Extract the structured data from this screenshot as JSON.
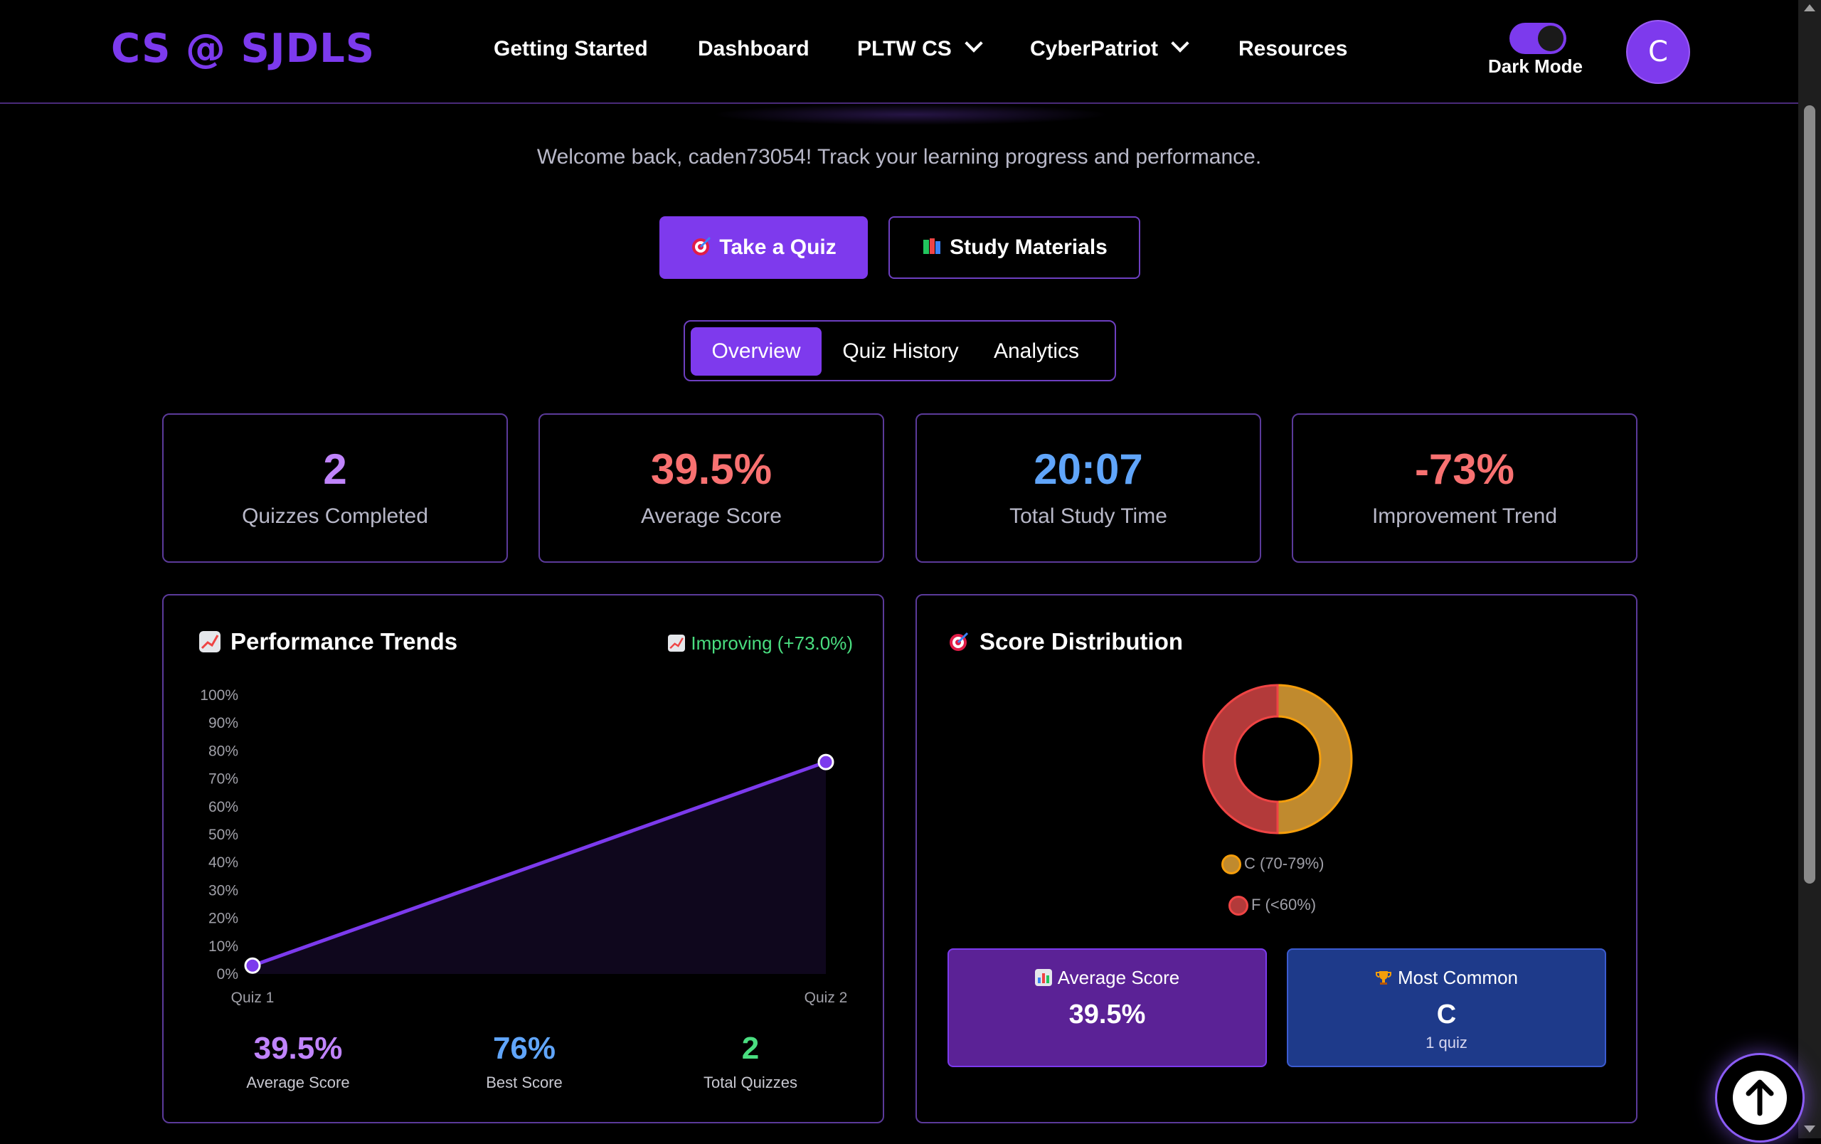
{
  "header": {
    "logo": "CS @ SJDLS",
    "nav": [
      "Getting Started",
      "Dashboard",
      "PLTW CS",
      "CyberPatriot",
      "Resources"
    ],
    "dark_mode_label": "Dark Mode",
    "dark_mode_on": true,
    "avatar_initial": "C"
  },
  "welcome": "Welcome back, caden73054! Track your learning progress and performance.",
  "actions": {
    "take_quiz": "Take a Quiz",
    "take_quiz_icon": "dart-target-icon",
    "study_materials": "Study Materials",
    "study_materials_icon": "books-icon"
  },
  "tabs": [
    "Overview",
    "Quiz History",
    "Analytics"
  ],
  "active_tab": "Overview",
  "stats": [
    {
      "value": "2",
      "label": "Quizzes Completed",
      "color": "#c084fc"
    },
    {
      "value": "39.5%",
      "label": "Average Score",
      "color": "#f87171"
    },
    {
      "value": "20:07",
      "label": "Total Study Time",
      "color": "#60a5fa"
    },
    {
      "value": "-73%",
      "label": "Improvement Trend",
      "color": "#f87171"
    }
  ],
  "trends": {
    "title": "Performance Trends",
    "badge": "Improving (+73.0%)",
    "summary": [
      {
        "value": "39.5%",
        "label": "Average Score",
        "color": "#c084fc"
      },
      {
        "value": "76%",
        "label": "Best Score",
        "color": "#60a5fa"
      },
      {
        "value": "2",
        "label": "Total Quizzes",
        "color": "#4ade80"
      }
    ]
  },
  "chart_data": {
    "type": "area",
    "categories": [
      "Quiz 1",
      "Quiz 2"
    ],
    "values": [
      3,
      76
    ],
    "ylim": [
      0,
      100
    ],
    "yticks": [
      "0%",
      "10%",
      "20%",
      "30%",
      "40%",
      "50%",
      "60%",
      "70%",
      "80%",
      "90%",
      "100%"
    ],
    "color": "#7c3aed"
  },
  "distribution": {
    "title": "Score Distribution",
    "slices": [
      {
        "label": "C (70-79%)",
        "value": 1,
        "color": "#c08a2e",
        "border": "#f59e0b"
      },
      {
        "label": "F (<60%)",
        "value": 1,
        "color": "#b33a3a",
        "border": "#ef4444"
      }
    ],
    "average": {
      "title": "Average Score",
      "value": "39.5%",
      "icon": "bar-chart-icon"
    },
    "most_common": {
      "title": "Most Common",
      "value": "C",
      "sub": "1 quiz",
      "icon": "trophy-icon"
    }
  }
}
